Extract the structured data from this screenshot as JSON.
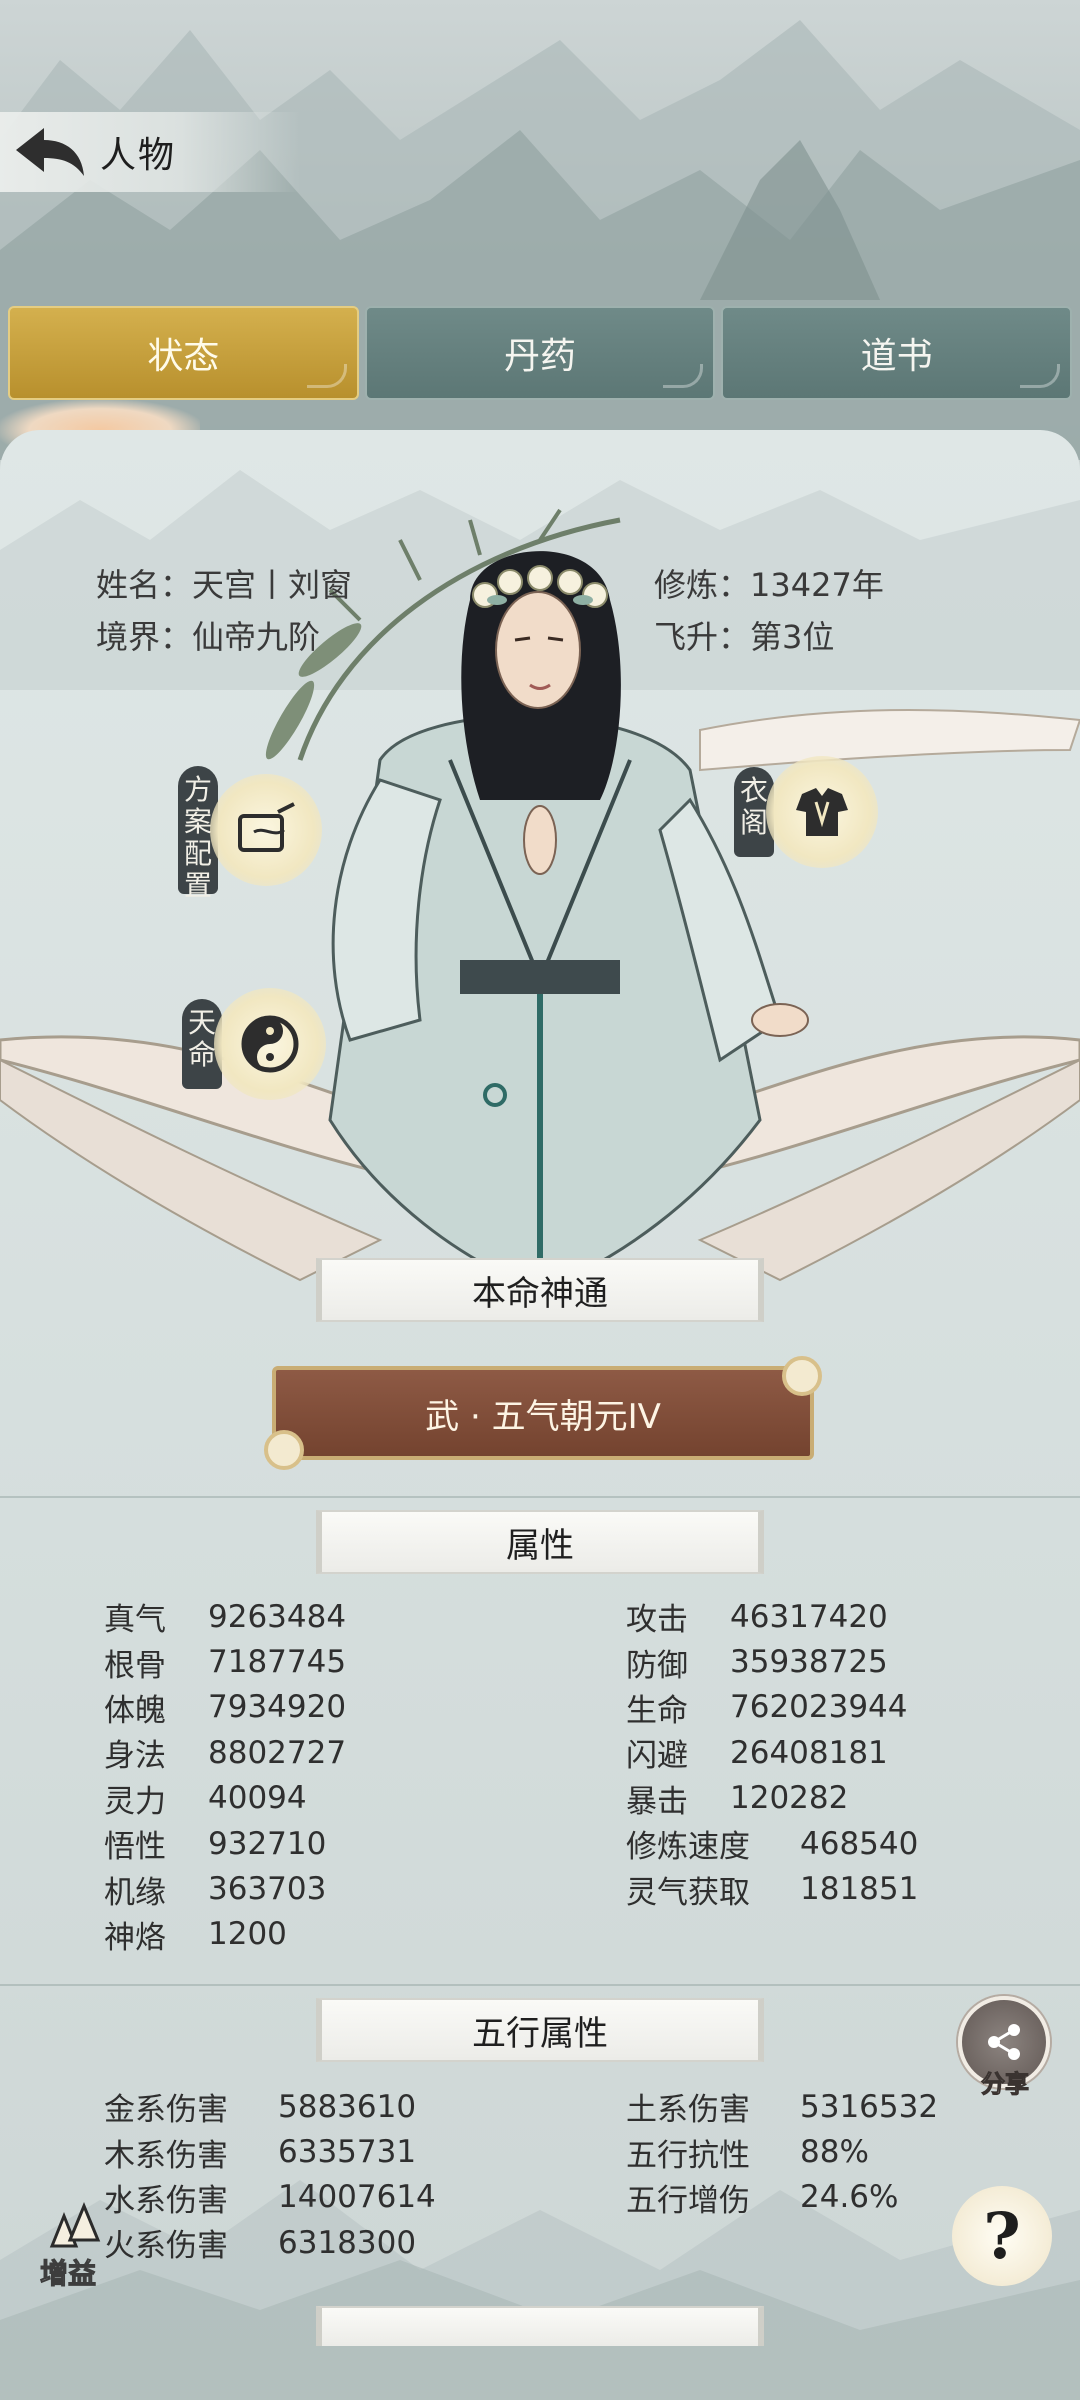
{
  "header": {
    "title": "人物"
  },
  "tabs": [
    {
      "label": "状态",
      "active": true
    },
    {
      "label": "丹药",
      "active": false
    },
    {
      "label": "道书",
      "active": false
    }
  ],
  "profile": {
    "name_key": "姓名：",
    "name": "天宫丨刘窗",
    "realm_key": "境界：",
    "realm": "仙帝九阶",
    "cultivation_key": "修炼：",
    "cultivation": "13427年",
    "ascension_key": "飞升：",
    "ascension": "第3位"
  },
  "side_buttons": {
    "plan": "方案配置",
    "wardrobe": "衣阁",
    "fate": "天命"
  },
  "sections": {
    "innate_skill": "本命神通",
    "attributes": "属性",
    "five_elements": "五行属性"
  },
  "innate_skill_value": "武 · 五气朝元IV",
  "attributes_left": [
    {
      "label": "真气",
      "value": "9263484"
    },
    {
      "label": "根骨",
      "value": "7187745"
    },
    {
      "label": "体魄",
      "value": "7934920"
    },
    {
      "label": "身法",
      "value": "8802727"
    },
    {
      "label": "灵力",
      "value": "40094"
    },
    {
      "label": "悟性",
      "value": "932710"
    },
    {
      "label": "机缘",
      "value": "363703"
    },
    {
      "label": "神烙",
      "value": "1200"
    }
  ],
  "attributes_right": [
    {
      "label": "攻击",
      "value": "46317420"
    },
    {
      "label": "防御",
      "value": "35938725"
    },
    {
      "label": "生命",
      "value": "762023944"
    },
    {
      "label": "闪避",
      "value": "26408181"
    },
    {
      "label": "暴击",
      "value": "120282"
    },
    {
      "label": "修炼速度",
      "value": "468540"
    },
    {
      "label": "灵气获取",
      "value": "181851"
    }
  ],
  "elements_left": [
    {
      "label": "金系伤害",
      "value": "5883610"
    },
    {
      "label": "木系伤害",
      "value": "6335731"
    },
    {
      "label": "水系伤害",
      "value": "14007614"
    },
    {
      "label": "火系伤害",
      "value": "6318300"
    }
  ],
  "elements_right": [
    {
      "label": "土系伤害",
      "value": "5316532"
    },
    {
      "label": "五行抗性",
      "value": "88%"
    },
    {
      "label": "五行增伤",
      "value": "24.6%"
    }
  ],
  "floating": {
    "share": "分享",
    "buff": "增益",
    "help": "?"
  },
  "colors": {
    "active_tab": "#c9a33f",
    "inactive_tab": "#66807e",
    "skill_button": "#7f4c37"
  }
}
